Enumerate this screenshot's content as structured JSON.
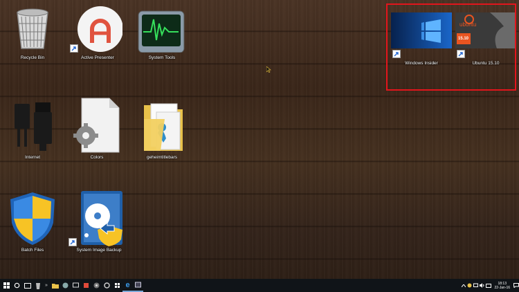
{
  "desktop": {
    "icons": [
      {
        "label": "Recycle Bin"
      },
      {
        "label": "Active Presenter"
      },
      {
        "label": "System Tools"
      },
      {
        "label": "Windows Insider"
      },
      {
        "label": "Ubuntu 15.10"
      },
      {
        "label": "Internet"
      },
      {
        "label": "Colors"
      },
      {
        "label": "geheimtitlebars"
      },
      {
        "label": "Batch Files"
      },
      {
        "label": "System Image Backup"
      }
    ],
    "ubuntu_thumb": {
      "brand": "ubuntu",
      "version": "15.10"
    },
    "highlight_color": "#e3151c"
  },
  "taskbar": {
    "chevron": "»",
    "clock": {
      "time": "18:13",
      "date": "22-Jan-16"
    },
    "icons": [
      "start-icon",
      "search-icon",
      "task-view-icon",
      "recycle-icon",
      "file-explorer-icon",
      "app-icon",
      "paint-icon",
      "media-icon",
      "settings-icon",
      "edge-icon",
      "ie-icon",
      "terminal-icon"
    ]
  }
}
